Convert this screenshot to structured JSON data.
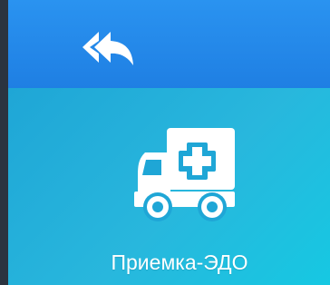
{
  "header": {
    "back_icon": "double-back-arrow-icon"
  },
  "tile": {
    "label": "Приемка-ЭДО",
    "icon": "ambulance-icon"
  },
  "colors": {
    "header": "#1f86e8",
    "panel_start": "#1fa6d6",
    "panel_end": "#16c8e2",
    "left_strip": "#2b3440",
    "icon_fill": "#ffffff",
    "label_color": "#ffffff"
  }
}
